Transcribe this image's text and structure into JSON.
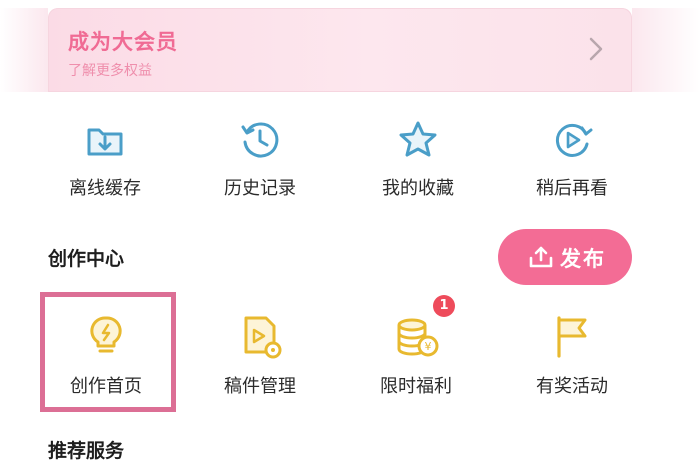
{
  "vip": {
    "title": "成为大会员",
    "subtitle": "了解更多权益"
  },
  "quick_actions": [
    {
      "label": "离线缓存",
      "icon": "download-folder-icon"
    },
    {
      "label": "历史记录",
      "icon": "history-clock-icon"
    },
    {
      "label": "我的收藏",
      "icon": "star-icon"
    },
    {
      "label": "稍后再看",
      "icon": "watch-later-icon"
    }
  ],
  "creation": {
    "title": "创作中心",
    "publish_label": "发布",
    "items": [
      {
        "label": "创作首页",
        "icon": "lightbulb-icon"
      },
      {
        "label": "稿件管理",
        "icon": "manuscript-icon"
      },
      {
        "label": "限时福利",
        "icon": "coins-icon",
        "badge": "1"
      },
      {
        "label": "有奖活动",
        "icon": "flag-icon"
      }
    ]
  },
  "recommended": {
    "title": "推荐服务"
  },
  "colors": {
    "accent_pink": "#f36c95",
    "icon_blue": "#4a9ec8",
    "icon_yellow": "#e8b92f",
    "badge_red": "#ee4b5b",
    "highlight_border": "#dc6f95"
  }
}
